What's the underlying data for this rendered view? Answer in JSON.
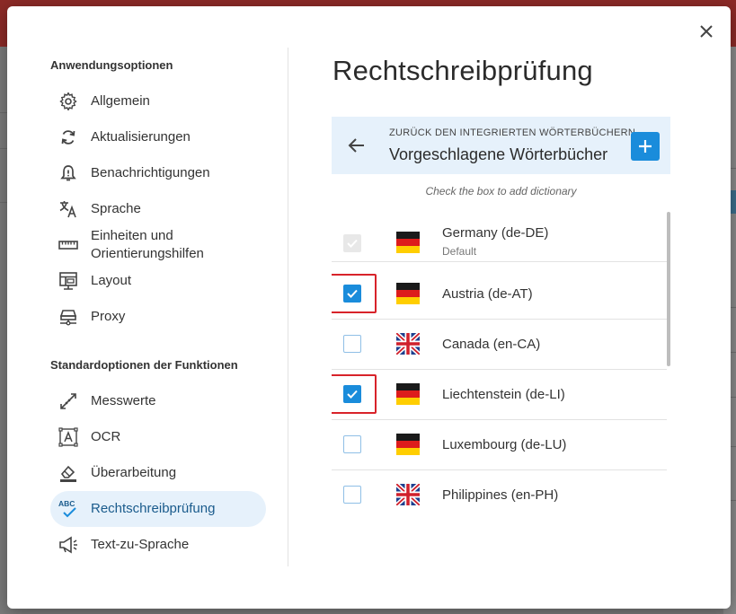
{
  "dialog": {
    "close_icon": "close-icon"
  },
  "nav": {
    "section1_title": "Anwendungsoptionen",
    "section1_items": [
      {
        "label": "Allgemein",
        "icon": "gear-icon"
      },
      {
        "label": "Aktualisierungen",
        "icon": "refresh-icon"
      },
      {
        "label": "Benachrichtigungen",
        "icon": "bell-icon"
      },
      {
        "label": "Sprache",
        "icon": "translate-icon"
      },
      {
        "label": "Einheiten und Orientierungshilfen",
        "icon": "ruler-icon"
      },
      {
        "label": "Layout",
        "icon": "layout-icon"
      },
      {
        "label": "Proxy",
        "icon": "proxy-icon"
      }
    ],
    "section2_title": "Standardoptionen der Funktionen",
    "section2_items": [
      {
        "label": "Messwerte",
        "icon": "measure-icon"
      },
      {
        "label": "OCR",
        "icon": "ocr-icon"
      },
      {
        "label": "Überarbeitung",
        "icon": "eraser-icon"
      },
      {
        "label": "Rechtschreibprüfung",
        "icon": "spellcheck-icon",
        "active": true
      },
      {
        "label": "Text-zu-Sprache",
        "icon": "megaphone-icon"
      }
    ]
  },
  "main": {
    "title": "Rechtschreibprüfung",
    "header_sub": "ZURÜCK DEN INTEGRIERTEN WÖRTERBÜCHERN",
    "header_title": "Vorgeschlagene Wörterbücher",
    "hint": "Check the box to add dictionary",
    "dictionaries": [
      {
        "label": "Germany (de-DE)",
        "sub": "Default",
        "checked": true,
        "disabled": true,
        "flag": "germany-flag",
        "highlighted": false
      },
      {
        "label": "Austria (de-AT)",
        "checked": true,
        "disabled": false,
        "flag": "germany-flag",
        "highlighted": true
      },
      {
        "label": "Canada (en-CA)",
        "checked": false,
        "disabled": false,
        "flag": "uk-flag",
        "highlighted": false
      },
      {
        "label": "Liechtenstein (de-LI)",
        "checked": true,
        "disabled": false,
        "flag": "germany-flag",
        "highlighted": true
      },
      {
        "label": "Luxembourg (de-LU)",
        "checked": false,
        "disabled": false,
        "flag": "germany-flag",
        "highlighted": false
      },
      {
        "label": "Philippines (en-PH)",
        "checked": false,
        "disabled": false,
        "flag": "uk-flag",
        "highlighted": false
      }
    ]
  },
  "colors": {
    "accent": "#1a8cdb",
    "highlight_outline": "#d8232a",
    "active_nav_bg": "#e6f1fb"
  }
}
